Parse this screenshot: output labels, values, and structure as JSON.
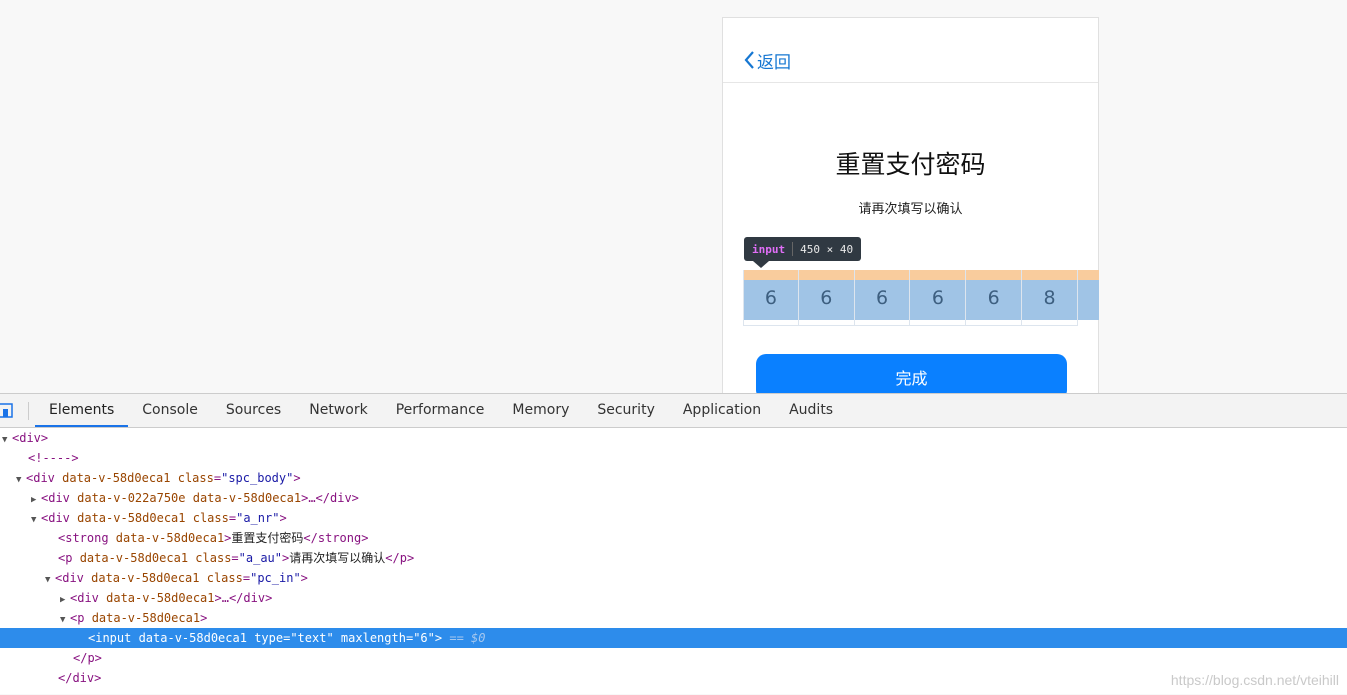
{
  "page": {
    "back_label": "返回",
    "title": "重置支付密码",
    "subtitle": "请再次填写以确认",
    "tooltip": {
      "tag": "input",
      "size": "450 × 40"
    },
    "digits": [
      "6",
      "6",
      "6",
      "6",
      "6",
      "8"
    ],
    "done_label": "完成"
  },
  "devtools": {
    "tabs": [
      "Elements",
      "Console",
      "Sources",
      "Network",
      "Performance",
      "Memory",
      "Security",
      "Application",
      "Audits"
    ],
    "active_tab": "Elements",
    "tree": {
      "l1": "<div>",
      "l2": "<!---->",
      "l3_open": "<div ",
      "l3_attr1": "data-v-58d0eca1",
      "l3_attr2": "class",
      "l3_val": "\"spc_body\"",
      "l4_a": "<div ",
      "l4_attr1": "data-v-022a750e",
      "l4_attr2": "data-v-58d0eca1",
      "l4_close": ">…</div>",
      "l5_open": "<div ",
      "l5_attr1": "data-v-58d0eca1",
      "l5_attr2": "class",
      "l5_val": "\"a_nr\"",
      "l6_open": "<strong ",
      "l6_attr": "data-v-58d0eca1",
      "l6_text": "重置支付密码",
      "l6_close": "</strong>",
      "l7_open": "<p ",
      "l7_attr1": "data-v-58d0eca1",
      "l7_attr2": "class",
      "l7_val": "\"a_au\"",
      "l7_text": "请再次填写以确认",
      "l7_close": "</p>",
      "l8_open": "<div ",
      "l8_attr1": "data-v-58d0eca1",
      "l8_attr2": "class",
      "l8_val": "\"pc_in\"",
      "l9_open": "<div ",
      "l9_attr": "data-v-58d0eca1",
      "l9_close": ">…</div>",
      "l10_open": "<p ",
      "l10_attr": "data-v-58d0eca1",
      "l11_open": "<input ",
      "l11_attr1": "data-v-58d0eca1",
      "l11_attr2": "type",
      "l11_val2": "\"text\"",
      "l11_attr3": "maxlength",
      "l11_val3": "\"6\"",
      "l11_eq": "== $0",
      "l12": "</p>",
      "l13": "</div>"
    },
    "watermark": "https://blog.csdn.net/vteihill"
  }
}
